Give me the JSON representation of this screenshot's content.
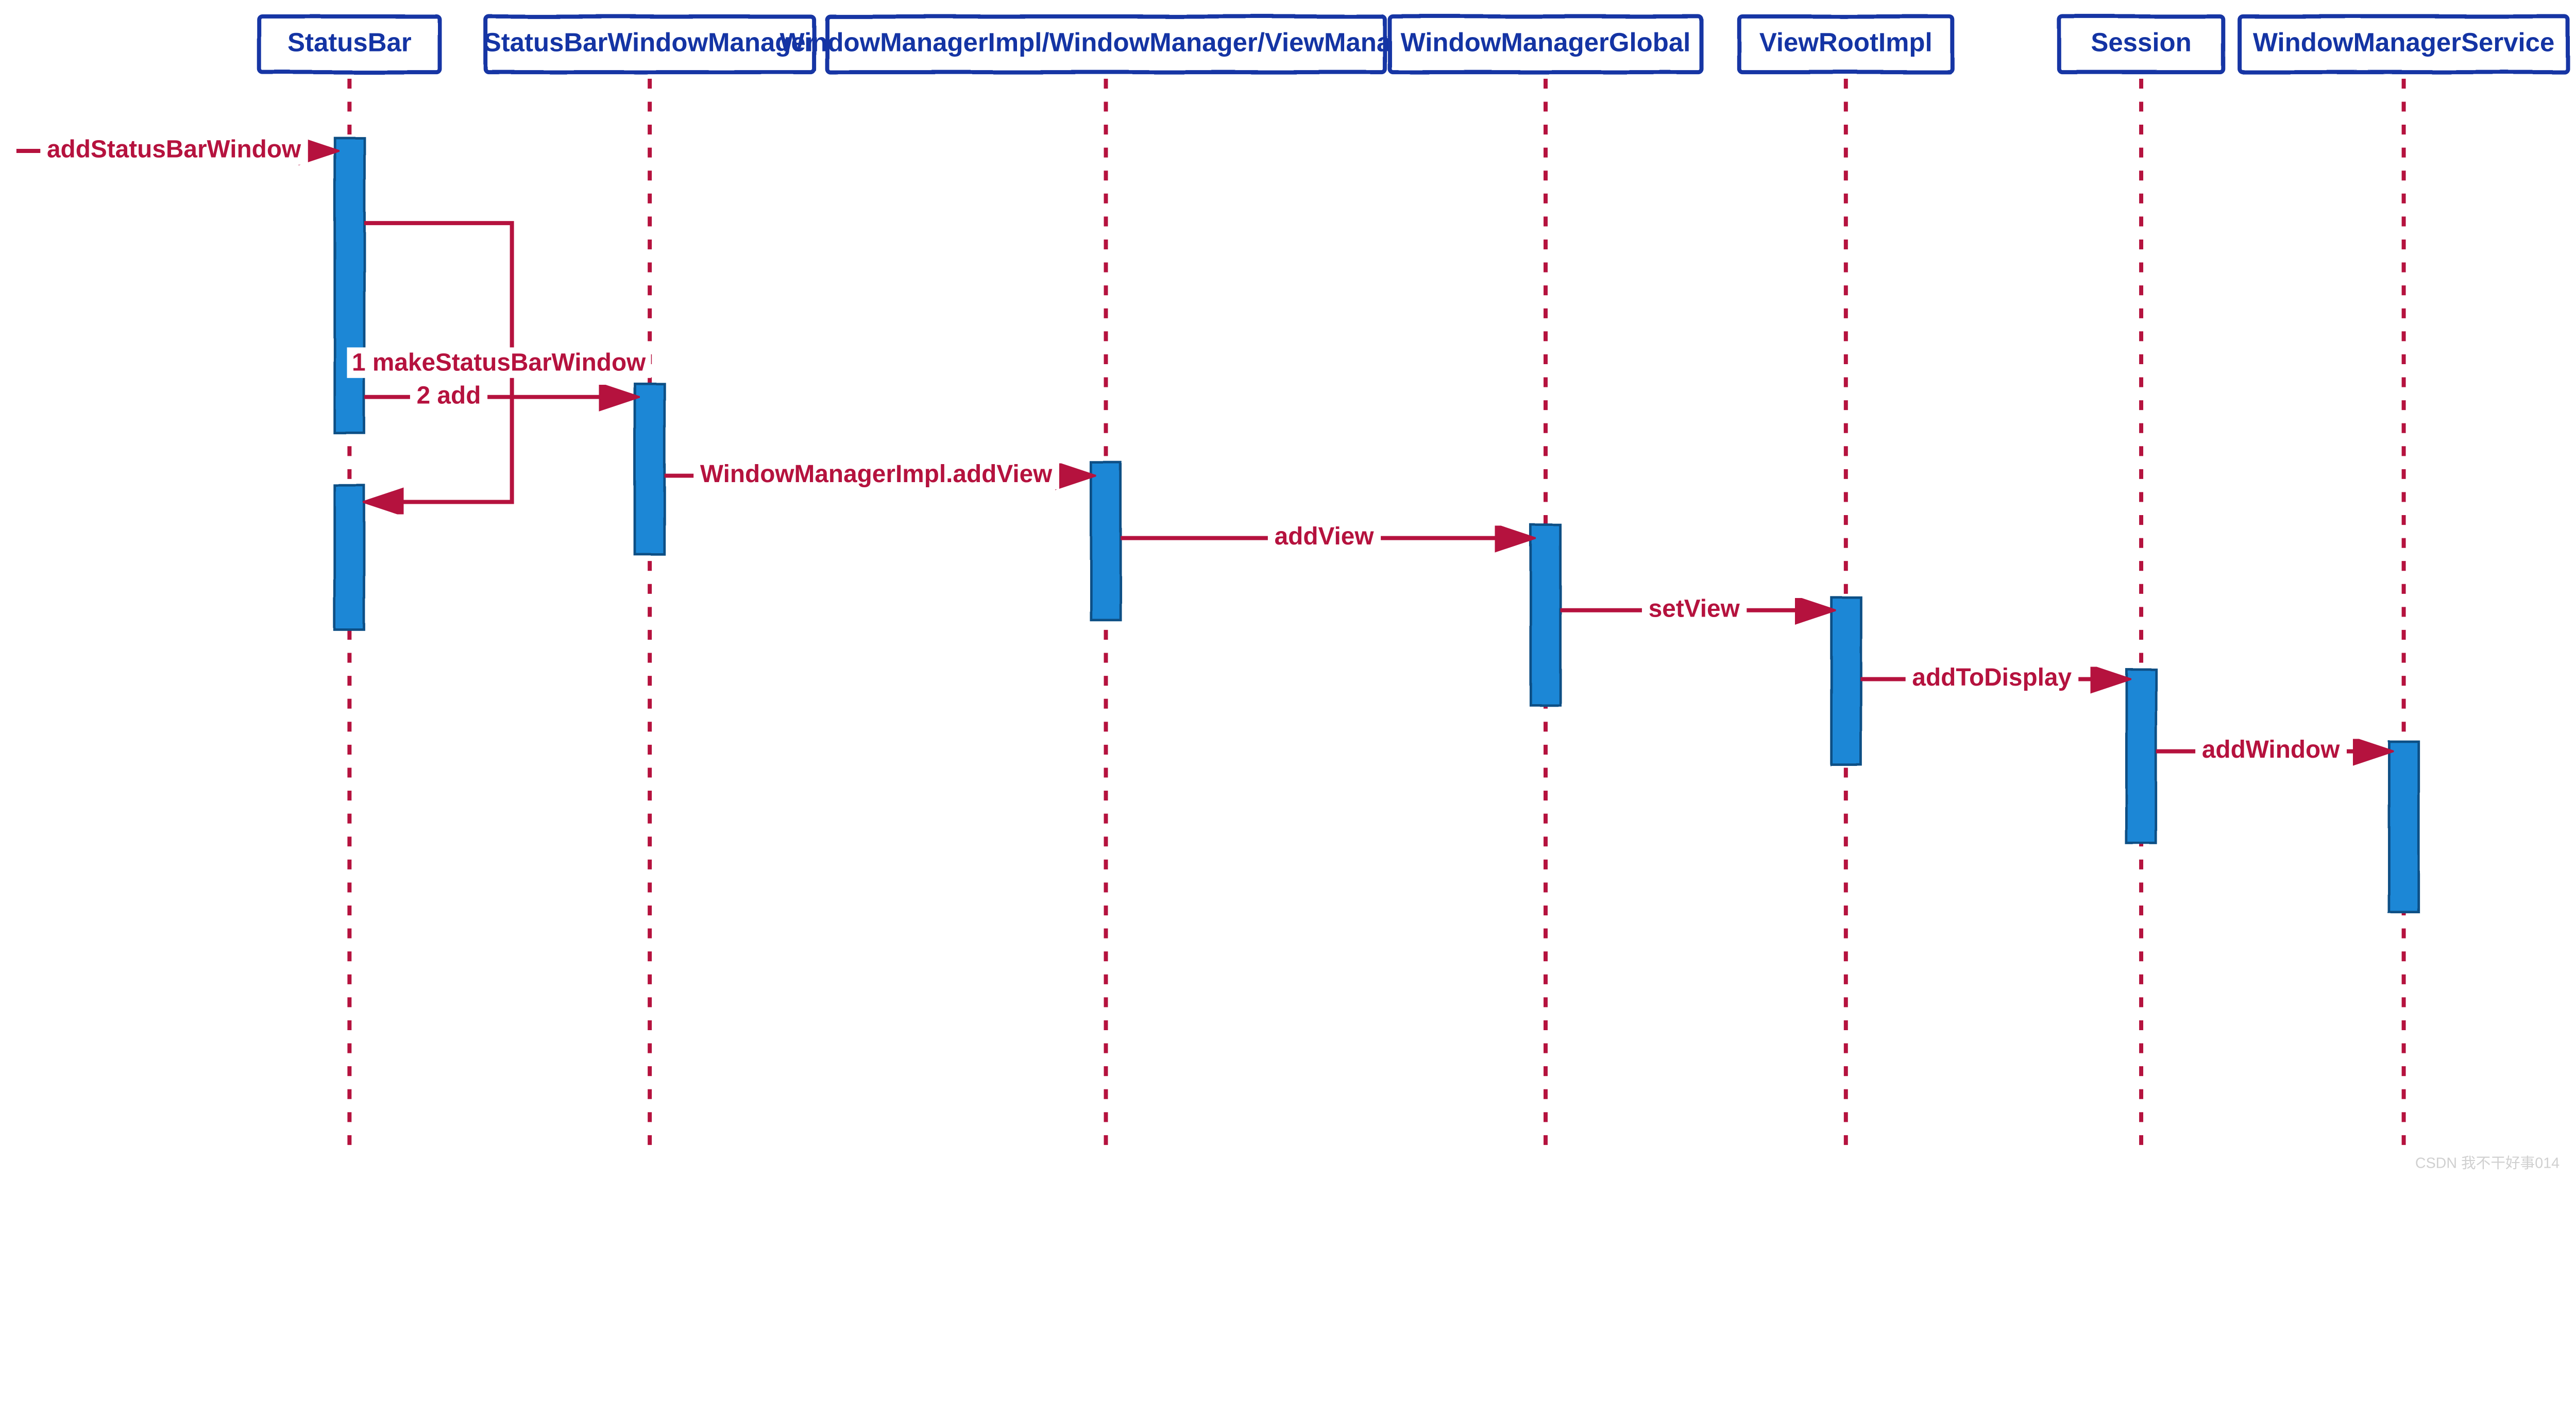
{
  "colors": {
    "boxStroke": "#1434a4",
    "boxText": "#1434a4",
    "line": "#b5123e",
    "activationFill": "#1e87d6",
    "activationStroke": "#0d4f85",
    "background": "#ffffff"
  },
  "participants": [
    {
      "id": "p0",
      "label": "StatusBar"
    },
    {
      "id": "p1",
      "label": "StatusBarWindowManager"
    },
    {
      "id": "p2",
      "label": "WindowManagerImpl/WindowManager/ViewManager"
    },
    {
      "id": "p3",
      "label": "WindowManagerGlobal"
    },
    {
      "id": "p4",
      "label": "ViewRootImpl"
    },
    {
      "id": "p5",
      "label": "Session"
    },
    {
      "id": "p6",
      "label": "WindowManagerService"
    }
  ],
  "messages": [
    {
      "id": "m0",
      "label": "addStatusBarWindow",
      "from": "ext",
      "to": "p0"
    },
    {
      "id": "m1",
      "label": "1 makeStatusBarWindow",
      "from": "p0",
      "to": "p0"
    },
    {
      "id": "m2",
      "label": "2 add",
      "from": "p0",
      "to": "p1"
    },
    {
      "id": "m3",
      "label": "WindowManagerImpl.addView",
      "from": "p1",
      "to": "p2"
    },
    {
      "id": "m4",
      "label": "addView",
      "from": "p2",
      "to": "p3"
    },
    {
      "id": "m5",
      "label": "setView",
      "from": "p3",
      "to": "p4"
    },
    {
      "id": "m6",
      "label": "addToDisplay",
      "from": "p4",
      "to": "p5"
    },
    {
      "id": "m7",
      "label": "addWindow",
      "from": "p5",
      "to": "p6"
    }
  ],
  "watermark": "CSDN 我不干好事014"
}
